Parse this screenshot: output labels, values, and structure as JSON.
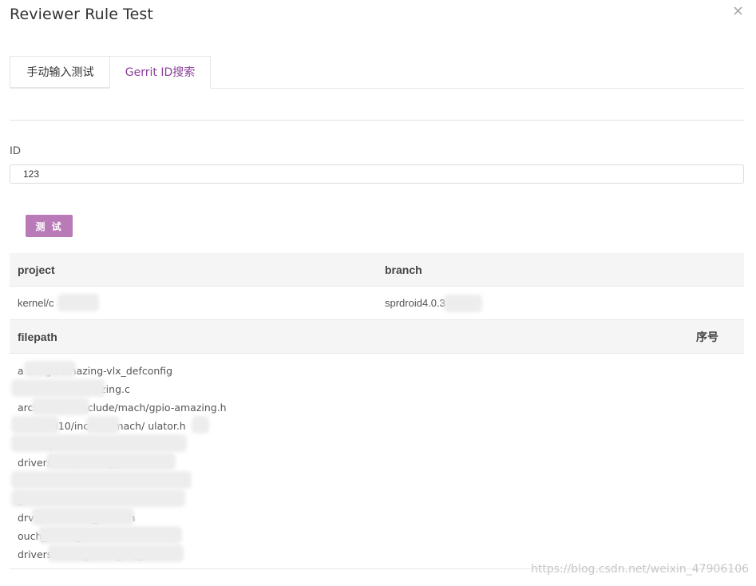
{
  "dialog": {
    "title": "Reviewer Rule Test"
  },
  "tabs": [
    {
      "label": "手动输入测试",
      "active": false
    },
    {
      "label": "Gerrit ID搜索",
      "active": true
    }
  ],
  "form": {
    "id_label": "ID",
    "id_value": "123",
    "test_button_label": "测 试"
  },
  "table": {
    "columns": {
      "project": "project",
      "branch": "branch",
      "filepath": "filepath",
      "seq": "序号"
    },
    "row": {
      "project": "kernel/c",
      "branch": "sprdroid4.0.3"
    },
    "files": [
      "a            onfigs/amazing-vlx_defconfig",
      "                 8810/board-amazing.c",
      "arcl           sc8810/include/mach/gpio-amazing.h",
      "             /mac      8810/include/mach/  ulator.h",
      "                                              mazing.h",
      "drivers                      een/Kconfig",
      "",
      "                                              _uch.c",
      "drv                     reen/zinitix_touch.h",
      "                                         ouch_bt4x3_firmware.h",
      "drivers/                                 ouch_bt4x3_reg_data.h"
    ]
  },
  "watermark": "https://blog.csdn.net/weixin_47906106",
  "colors": {
    "accent": "#8b3f9a",
    "button": "#b97ab8",
    "header_bg": "#f5f5f5",
    "border": "#e6e6e6"
  },
  "icons": {
    "close": "close-icon"
  }
}
